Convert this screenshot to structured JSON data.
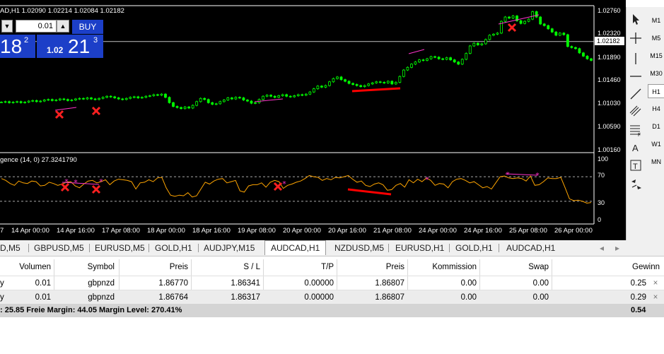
{
  "chart": {
    "symbol_info": "AD,H1  1.02090 1.02214 1.02084 1.02182",
    "current_price": "1.02182",
    "price_labels": [
      "1.02760",
      "1.02320",
      "1.01890",
      "1.01460",
      "1.01030",
      "1.00590",
      "1.00160"
    ],
    "oscillator_title": "gence (14, 0) 27.3241790",
    "oscillator_levels": [
      "70",
      "30",
      "100",
      "0"
    ],
    "time_labels": [
      "7",
      "14 Apr 00:00",
      "14 Apr 16:00",
      "17 Apr 08:00",
      "18 Apr 00:00",
      "18 Apr 16:00",
      "19 Apr 08:00",
      "20 Apr 00:00",
      "20 Apr 16:00",
      "21 Apr 08:00",
      "24 Apr 00:00",
      "24 Apr 16:00",
      "25 Apr 08:00",
      "26 Apr 00:00"
    ],
    "colors": {
      "background": "#000000",
      "candles": "#00ff00",
      "oscillator": "#ffa500",
      "divergence_line": "#ff0000",
      "marker": "#ff33cc"
    },
    "price_series": [
      1.0105,
      1.0106,
      1.0104,
      1.0105,
      1.0106,
      1.0104,
      1.0105,
      1.0107,
      1.0108,
      1.0106,
      1.0107,
      1.0109,
      1.011,
      1.0108,
      1.0109,
      1.0111,
      1.011,
      1.0108,
      1.0109,
      1.0111,
      1.0112,
      1.0111,
      1.0113,
      1.0111,
      1.011,
      1.0112,
      1.0114,
      1.0116,
      1.0115,
      1.0113,
      1.0111,
      1.011,
      1.0112,
      1.0114,
      1.0115,
      1.0113,
      1.0114,
      1.0116,
      1.0117,
      1.0119,
      1.0118,
      1.012,
      1.0114,
      1.0104,
      1.0097,
      1.0095,
      1.0093,
      1.0096,
      1.0094,
      1.0099,
      1.0106,
      1.0112,
      1.011,
      1.0104,
      1.0101,
      1.0102,
      1.0106,
      1.0109,
      1.0113,
      1.0111,
      1.0114,
      1.0113,
      1.0109,
      1.0107,
      1.0103,
      1.0104,
      1.011,
      1.0116,
      1.0118,
      1.0116,
      1.0114,
      1.0117,
      1.0119,
      1.0116,
      1.0115,
      1.0117,
      1.0119,
      1.0118,
      1.012,
      1.0124,
      1.013,
      1.0135,
      1.0133,
      1.0136,
      1.0143,
      1.0149,
      1.0152,
      1.0147,
      1.0144,
      1.014,
      1.0138,
      1.0136,
      1.0134,
      1.0136,
      1.0139,
      1.0141,
      1.0143,
      1.0142,
      1.0141,
      1.0144,
      1.0139,
      1.0142,
      1.0153,
      1.0165,
      1.017,
      1.0176,
      1.018,
      1.0184,
      1.0183,
      1.0186,
      1.019,
      1.0189,
      1.0186,
      1.0185,
      1.0188,
      1.0184,
      1.018,
      1.0176,
      1.0185,
      1.0196,
      1.021,
      1.0215,
      1.0212,
      1.0214,
      1.0222,
      1.023,
      1.0232,
      1.0234,
      1.0256,
      1.0264,
      1.0262,
      1.0266,
      1.0257,
      1.0252,
      1.0256,
      1.026,
      1.0274,
      1.0264,
      1.0251,
      1.0248,
      1.0242,
      1.0236,
      1.023,
      1.0234,
      1.0231,
      1.0209,
      1.0207,
      1.0205,
      1.0197,
      1.0191,
      1.0186,
      1.0183
    ],
    "osc_series": [
      67,
      64,
      59,
      56,
      63,
      60,
      59,
      63,
      62,
      55,
      56,
      61,
      59,
      56,
      58,
      61,
      62,
      55,
      52,
      58,
      63,
      64,
      60,
      62,
      65,
      57,
      63,
      66,
      65,
      64,
      62,
      50,
      60,
      61,
      65,
      62,
      68,
      69,
      52,
      40,
      38,
      40,
      39,
      44,
      37,
      39,
      50,
      61,
      58,
      63,
      66,
      67,
      60,
      62,
      64,
      47,
      45,
      55,
      57,
      57,
      60,
      53,
      61,
      64,
      62,
      51,
      56,
      58,
      61,
      63,
      67,
      72,
      70,
      69,
      64,
      67,
      65,
      69,
      68,
      70,
      72,
      66,
      61,
      63,
      56,
      54,
      58,
      60,
      57,
      48,
      49,
      56,
      59,
      53,
      65,
      60,
      66,
      62,
      68,
      64,
      56,
      59,
      58,
      52,
      62,
      66,
      67,
      64,
      60,
      62,
      57,
      52,
      54,
      50,
      60,
      70,
      71,
      68,
      67,
      68,
      67,
      63,
      71,
      56,
      57,
      62,
      68,
      67,
      67,
      69,
      52,
      34,
      31,
      32,
      30,
      27,
      28
    ]
  },
  "oneclick": {
    "lot": "0.01",
    "buy_label": "BUY",
    "sell_big": "18",
    "sell_sup": "2",
    "buy_small": "1.02",
    "buy_big": "21",
    "buy_sup": "3",
    "dec_arrow": "▼",
    "inc_arrow": "▲"
  },
  "toolbar": {
    "timeframes": [
      "M1",
      "M5",
      "M15",
      "M30",
      "H1",
      "H4",
      "D1",
      "W1",
      "MN"
    ],
    "active_timeframe": "H1",
    "tools": [
      "cursor-icon",
      "crosshair-icon",
      "vertical-line-icon",
      "horizontal-line-icon",
      "trendline-icon",
      "channel-icon",
      "fibonacci-icon",
      "text-icon",
      "text-label-icon",
      "arrows-icon"
    ]
  },
  "tabs": [
    "D,M5",
    "GBPUSD,M5",
    "EURUSD,M5",
    "GOLD,H1",
    "AUDJPY,M15",
    "AUDCAD,H1",
    "NZDUSD,M5",
    "EURUSD,H1",
    "GOLD,H1",
    "AUDCAD,H1"
  ],
  "active_tab": "AUDCAD,H1",
  "tab_nav": {
    "left": "◂",
    "right": "▸"
  },
  "table": {
    "headers": [
      "Volumen",
      "Symbol",
      "Preis",
      "S / L",
      "T/P",
      "Preis",
      "Kommission",
      "Swap",
      "Gewinn"
    ],
    "rows": [
      {
        "type": "y",
        "volume": "0.01",
        "symbol": "gbpnzd",
        "price": "1.86770",
        "sl": "1.86341",
        "tp": "0.00000",
        "price2": "1.86807",
        "commission": "0.00",
        "swap": "0.00",
        "profit": "0.25",
        "close": "×"
      },
      {
        "type": "y",
        "volume": "0.01",
        "symbol": "gbpnzd",
        "price": "1.86764",
        "sl": "1.86317",
        "tp": "0.00000",
        "price2": "1.86807",
        "commission": "0.00",
        "swap": "0.00",
        "profit": "0.29",
        "close": "×"
      }
    ],
    "status": ": 25.85  Freie Margin: 44.05  Margin Level: 270.41%",
    "status_total": "0.54"
  }
}
